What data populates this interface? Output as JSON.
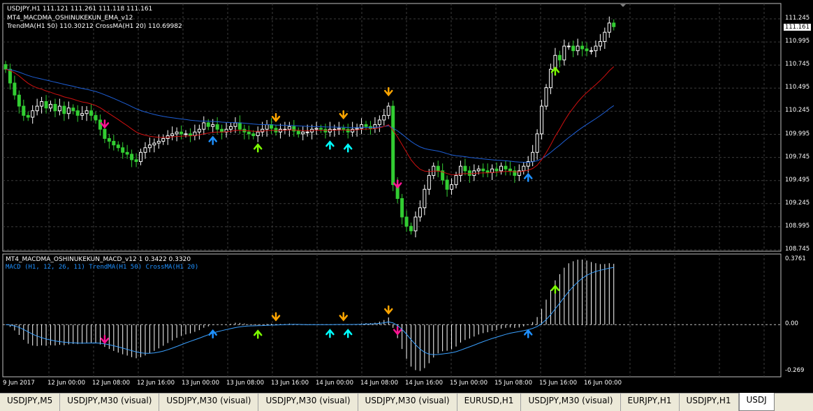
{
  "main": {
    "symbol_line": "USDJPY,H1  111.121 111.261 111.118 111.161",
    "indicator_name": "MT4_MACDMA_OSHINUKEKUN_EMA_v12",
    "ma_line": "TrendMA(H1 50) 110.30212 CrossMA(H1 20) 110.69982",
    "current_price": "111.161",
    "y_labels": [
      "111.245",
      "110.995",
      "110.745",
      "110.495",
      "110.245",
      "109.995",
      "109.745",
      "109.495",
      "109.245",
      "108.995",
      "108.745"
    ]
  },
  "sub": {
    "indicator_line": "MT4_MACDMA_OSHINUKEKUN_MACD_v12 1 0.3422 0.3320",
    "macd_line": "MACD (H1, 12, 26, 11) TrendMA(H1 50) CrossMA(H1 20)",
    "y_labels": [
      "0.3761",
      "0.00",
      "-0.269"
    ]
  },
  "x_labels": [
    "9 Jun 2017",
    "12 Jun 00:00",
    "12 Jun 08:00",
    "12 Jun 16:00",
    "13 Jun 00:00",
    "13 Jun 08:00",
    "13 Jun 16:00",
    "14 Jun 00:00",
    "14 Jun 08:00",
    "14 Jun 16:00",
    "15 Jun 00:00",
    "15 Jun 08:00",
    "15 Jun 16:00",
    "16 Jun 00:00"
  ],
  "tabs": [
    "USDJPY,M5",
    "USDJPY,M30 (visual)",
    "USDJPY,M30 (visual)",
    "USDJPY,M30 (visual)",
    "USDJPY,M30 (visual)",
    "EURUSD,H1",
    "USDJPY,M30 (visual)",
    "EURJPY,H1",
    "USDJPY,H1",
    "USDJ"
  ],
  "active_tab_index": 9,
  "colors": {
    "background": "#000000",
    "bull_candle": "#ffffff",
    "bear_candle": "#32cd32",
    "trend_ma": "#1e5fd6",
    "cross_ma": "#d01010",
    "macd_signal": "#3aa0ff",
    "arrow_magenta": "#ff1493",
    "arrow_orange": "#ffa500",
    "arrow_blue": "#1e90ff",
    "arrow_cyan": "#00ffff",
    "arrow_green": "#7cfc00"
  },
  "chart_data": {
    "type": "candlestick",
    "timeframe": "H1",
    "symbol": "USDJPY",
    "ylim_price": [
      108.745,
      111.245
    ],
    "ylim_macd": [
      -0.269,
      0.3761
    ],
    "closes": [
      110.7,
      110.55,
      110.42,
      110.3,
      110.2,
      110.18,
      110.25,
      110.3,
      110.35,
      110.28,
      110.32,
      110.25,
      110.3,
      110.22,
      110.28,
      110.25,
      110.2,
      110.22,
      110.25,
      110.2,
      110.15,
      110.05,
      109.95,
      109.92,
      109.88,
      109.85,
      109.8,
      109.78,
      109.72,
      109.7,
      109.8,
      109.85,
      109.88,
      109.9,
      109.92,
      109.95,
      109.98,
      110.0,
      110.02,
      110.0,
      110.0,
      109.98,
      110.02,
      110.05,
      110.12,
      110.08,
      110.1,
      110.05,
      110.02,
      110.05,
      110.08,
      110.12,
      110.05,
      110.02,
      110.0,
      109.98,
      110.02,
      110.05,
      110.1,
      110.06,
      110.02,
      110.05,
      110.05,
      110.08,
      110.03,
      110.0,
      110.02,
      110.02,
      110.05,
      110.06,
      110.05,
      110.02,
      110.05,
      110.05,
      110.06,
      110.05,
      110.02,
      110.05,
      110.06,
      110.1,
      110.08,
      110.06,
      110.1,
      110.15,
      110.2,
      110.3,
      109.45,
      109.3,
      109.1,
      109.0,
      108.95,
      109.1,
      109.2,
      109.4,
      109.55,
      109.65,
      109.6,
      109.5,
      109.4,
      109.45,
      109.55,
      109.65,
      109.6,
      109.55,
      109.6,
      109.62,
      109.6,
      109.58,
      109.62,
      109.6,
      109.65,
      109.62,
      109.6,
      109.55,
      109.6,
      109.65,
      109.7,
      109.8,
      110.0,
      110.3,
      110.5,
      110.7,
      110.85,
      110.8,
      110.95,
      110.95,
      110.9,
      110.95,
      110.92,
      110.9,
      110.9,
      110.95,
      111.0,
      111.1,
      111.2,
      111.16
    ],
    "trend_ma_last": 110.30212,
    "cross_ma_last": 110.69982,
    "macd_last": 0.3422,
    "signal_last": 0.332,
    "signals": [
      {
        "index": 22,
        "type": "sell",
        "color": "magenta"
      },
      {
        "index": 46,
        "type": "buy",
        "color": "blue"
      },
      {
        "index": 56,
        "type": "buy",
        "color": "green"
      },
      {
        "index": 60,
        "type": "sell",
        "color": "orange"
      },
      {
        "index": 72,
        "type": "buy",
        "color": "cyan"
      },
      {
        "index": 75,
        "type": "sell",
        "color": "orange"
      },
      {
        "index": 76,
        "type": "buy",
        "color": "cyan"
      },
      {
        "index": 85,
        "type": "sell",
        "color": "orange"
      },
      {
        "index": 87,
        "type": "sell",
        "color": "magenta"
      },
      {
        "index": 116,
        "type": "buy",
        "color": "blue"
      },
      {
        "index": 122,
        "type": "buy",
        "color": "green"
      }
    ]
  }
}
